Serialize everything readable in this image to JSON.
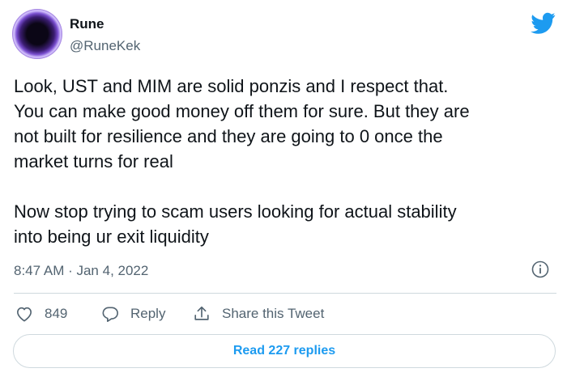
{
  "author": {
    "name": "Rune",
    "handle": "@RuneKek",
    "avatar_icon": "avatar-portal-icon"
  },
  "brand": {
    "logo_icon": "twitter-bird-icon",
    "accent_color": "#1d9bf0"
  },
  "tweet": {
    "text": "Look, UST and MIM are solid ponzis and I respect that.\nYou can make good money off them for sure. But they are\nnot built for resilience and they are going to 0 once the\nmarket turns for real\n\nNow stop trying to scam users looking for actual stability\ninto being ur exit liquidity",
    "timestamp": "8:47 AM · Jan 4, 2022",
    "info_icon": "info-icon"
  },
  "actions": {
    "like_count": "849",
    "reply_label": "Reply",
    "share_label": "Share this Tweet"
  },
  "replies_button_label": "Read 227 replies"
}
